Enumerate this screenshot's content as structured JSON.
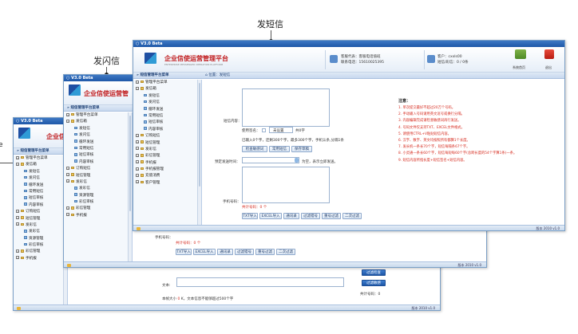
{
  "labels": {
    "main": "发短信",
    "flash": "发闪信",
    "left_cut": "e"
  },
  "colors": {
    "titlebar": "#2a64b3",
    "brand_red": "#c0191b",
    "notice_red": "#d62b1f"
  },
  "win1": {
    "version": "V3.0 Beta",
    "app_title": "企业信",
    "nav_label": "短信管理平台菜单",
    "tree": [
      {
        "level": 1,
        "text": "管理平台菜单",
        "icon": "root-folder-icon"
      },
      {
        "level": 1,
        "text": "发信箱",
        "icon": "folder-icon"
      },
      {
        "level": 2,
        "text": "发短信",
        "icon": "page-icon"
      },
      {
        "level": 2,
        "text": "发闪信",
        "icon": "page-icon"
      },
      {
        "level": 2,
        "text": "循环发送",
        "icon": "page-icon"
      },
      {
        "level": 2,
        "text": "常用短信",
        "icon": "page-icon"
      },
      {
        "level": 2,
        "text": "短信审核",
        "icon": "page-icon"
      },
      {
        "level": 2,
        "text": "内容审核",
        "icon": "page-icon"
      },
      {
        "level": 1,
        "text": "订购短信",
        "icon": "folder-icon"
      },
      {
        "level": 1,
        "text": "短信管理",
        "icon": "folder-icon"
      },
      {
        "level": 1,
        "text": "发彩信",
        "icon": "folder-icon"
      },
      {
        "level": 2,
        "text": "发彩信",
        "icon": "page-icon"
      },
      {
        "level": 2,
        "text": "资源管理",
        "icon": "page-icon"
      },
      {
        "level": 2,
        "text": "彩信审核",
        "icon": "page-icon"
      },
      {
        "level": 1,
        "text": "彩信管理",
        "icon": "folder-icon"
      },
      {
        "level": 1,
        "text": "手机报",
        "icon": "folder-icon"
      }
    ],
    "content": {
      "label_text": "文本:",
      "size_prefix": "本帧大小",
      "size_value": "0",
      "size_suffix": "K，文本信息不能够超过500个字",
      "btn_preview": "过滤检查",
      "btn_cut": "过滤敏感",
      "count": "共计号码：0"
    },
    "footer": "版本 2010 v1.0"
  },
  "win2": {
    "version": "V3.0 Beta",
    "app_title": "企业信使运营管",
    "nav_label": "短信管理平台菜单",
    "tree": [
      {
        "level": 1,
        "text": "管理平台菜单",
        "icon": "root-folder-icon"
      },
      {
        "level": 1,
        "text": "发信箱",
        "icon": "folder-icon"
      },
      {
        "level": 2,
        "text": "发短信",
        "icon": "page-icon"
      },
      {
        "level": 2,
        "text": "发闪信",
        "icon": "page-icon"
      },
      {
        "level": 2,
        "text": "循环发送",
        "icon": "page-icon"
      },
      {
        "level": 2,
        "text": "常用短信",
        "icon": "page-icon"
      },
      {
        "level": 2,
        "text": "短信审核",
        "icon": "page-icon"
      },
      {
        "level": 2,
        "text": "内容审核",
        "icon": "page-icon"
      },
      {
        "level": 1,
        "text": "订购短信",
        "icon": "folder-icon"
      },
      {
        "level": 1,
        "text": "短信管理",
        "icon": "folder-icon"
      },
      {
        "level": 1,
        "text": "发彩信",
        "icon": "folder-icon"
      },
      {
        "level": 2,
        "text": "发彩信",
        "icon": "page-icon"
      },
      {
        "level": 2,
        "text": "资源管理",
        "icon": "page-icon"
      },
      {
        "level": 2,
        "text": "彩信审核",
        "icon": "page-icon"
      },
      {
        "level": 1,
        "text": "彩信管理",
        "icon": "folder-icon"
      },
      {
        "level": 1,
        "text": "手机报",
        "icon": "folder-icon"
      }
    ],
    "content": {
      "phone_label": "手机号码：",
      "count": "共计号码：0 个",
      "buttons": [
        "TXT导入",
        "EXCEL导入",
        "通讯录",
        "过滤错号",
        "重号过滤",
        "二次过滤"
      ]
    },
    "footer": "版本 2010 v1.0"
  },
  "win3": {
    "version": "V3.0 Beta",
    "app_title": "企业信使运营管理平台",
    "app_subtitle": "ENTERPRISE  MESSENGER  OPERATION  PLATFORM",
    "service_name": "客服代表：客服电话值班",
    "service_phone": "联系电话：15610025395",
    "customer": "客户：cxxls00",
    "balance": "短信/彩信：0 / 0条",
    "home_label": "系统首页",
    "logout_label": "退出",
    "nav_label": "短信管理平台菜单",
    "location": "位置：发短信",
    "tree": [
      {
        "level": 1,
        "text": "管理平台菜单",
        "icon": "root-folder-icon"
      },
      {
        "level": 1,
        "text": "发信箱",
        "icon": "folder-icon"
      },
      {
        "level": 2,
        "text": "发短信",
        "icon": "page-icon"
      },
      {
        "level": 2,
        "text": "发闪信",
        "icon": "page-icon"
      },
      {
        "level": 2,
        "text": "循环发送",
        "icon": "page-icon"
      },
      {
        "level": 2,
        "text": "常用短信",
        "icon": "page-icon"
      },
      {
        "level": 2,
        "text": "短信审核",
        "icon": "page-icon"
      },
      {
        "level": 2,
        "text": "内容审核",
        "icon": "page-icon"
      },
      {
        "level": 1,
        "text": "订购短信",
        "icon": "folder-icon"
      },
      {
        "level": 1,
        "text": "短信管理",
        "icon": "folder-icon"
      },
      {
        "level": 1,
        "text": "发彩信",
        "icon": "folder-icon"
      },
      {
        "level": 1,
        "text": "彩信管理",
        "icon": "folder-icon"
      },
      {
        "level": 1,
        "text": "手机报",
        "icon": "folder-icon"
      },
      {
        "level": 1,
        "text": "手机报管理",
        "icon": "folder-icon"
      },
      {
        "level": 1,
        "text": "充值消费",
        "icon": "folder-icon"
      },
      {
        "level": 1,
        "text": "客户管理",
        "icon": "folder-icon"
      }
    ],
    "form": {
      "content_label": "短信内容：",
      "signature_label": "使用签名：",
      "signature_value": "未设置",
      "signature_count": "共0字",
      "stats_text": "已输入0个字，还剩300个字，最多300个字，手机认条,分隔1条",
      "btn_check": "检查敏感词",
      "btn_common": "常用短信",
      "btn_save": "保存草稿",
      "sched_label": "预定发送时间：",
      "sched_hint": "为空，表示立即发送。",
      "phone_label": "手机号码：",
      "count": "共计号码：0 个",
      "buttons": [
        "TXT导入",
        "EXCEL导入",
        "通讯录",
        "过滤错号",
        "重号过滤",
        "二次过滤"
      ]
    },
    "notice": {
      "title": "注意：",
      "lines": [
        "1. 单次提交最好不超过20万个号码。",
        "2. 手动输入号码请用英文逗号或换行分隔。",
        "3. 内容编辑完成请检查敏感词再行发送。",
        "4. 号码文件仅支持TXT、EXCEL文件格式。",
        "5. 请使用CTRL+V粘贴短信内容。",
        "6. 汉字、数字、英文均按照所有都算1个长度。",
        "7. 发长机一条长70个字，短信每隔条67个字。",
        "8. 小灵通一条长60个字，短信每短每60个字(总跨长度的54个字算1条)一条。",
        "9. 短信内容所指长度+短信签名+短信内容。"
      ]
    },
    "footer": "版本 2010 v1.0"
  }
}
